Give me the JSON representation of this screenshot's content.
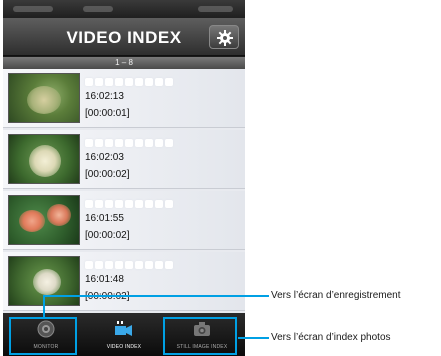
{
  "header": {
    "title": "VIDEO INDEX",
    "settings_icon": "gear-icon"
  },
  "range_label": "1 – 8",
  "videos": [
    {
      "time": "16:02:13",
      "duration": "[00:00:01]"
    },
    {
      "time": "16:02:03",
      "duration": "[00:00:02]"
    },
    {
      "time": "16:01:55",
      "duration": "[00:00:02]"
    },
    {
      "time": "16:01:48",
      "duration": "[00:00:02]"
    }
  ],
  "tabs": [
    {
      "label": "MONITOR",
      "icon": "camera-lens-icon"
    },
    {
      "label": "VIDEO INDEX",
      "icon": "video-index-icon"
    },
    {
      "label": "STILL IMAGE INDEX",
      "icon": "camera-icon"
    }
  ],
  "callouts": {
    "recording": "Vers l’écran d’enregistrement",
    "photo_index": "Vers l’écran d’index photos"
  },
  "colors": {
    "callout": "#00a0e4",
    "highlight_border": "#00a0e4"
  }
}
